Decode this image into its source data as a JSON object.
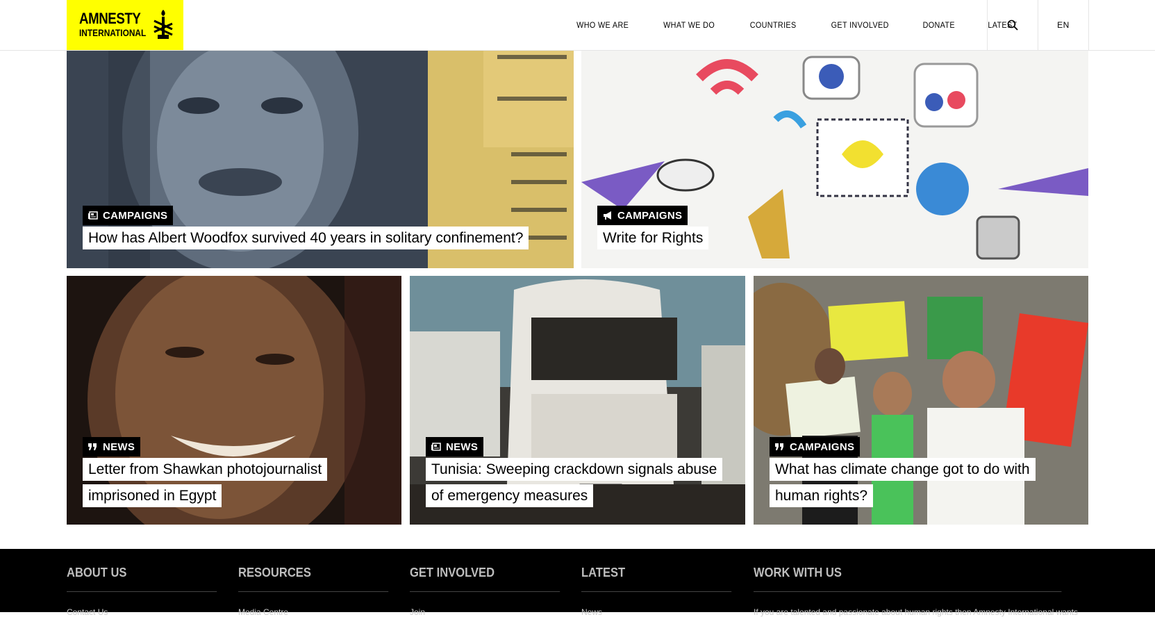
{
  "brand": {
    "line1": "AMNESTY",
    "line2": "INTERNATIONAL"
  },
  "nav": {
    "items": [
      "WHO WE ARE",
      "WHAT WE DO",
      "COUNTRIES",
      "GET INVOLVED",
      "DONATE",
      "LATEST"
    ],
    "search_icon": "search-icon",
    "language": "EN"
  },
  "cards": [
    {
      "tag": "CAMPAIGNS",
      "tag_icon": "newspaper-icon",
      "title": "How has Albert Woodfox survived 40 years in solitary confinement?"
    },
    {
      "tag": "CAMPAIGNS",
      "tag_icon": "megaphone-icon",
      "title": "Write for Rights"
    },
    {
      "tag": "NEWS",
      "tag_icon": "quote-icon",
      "title": "Letter from Shawkan photojournalist imprisoned in Egypt"
    },
    {
      "tag": "NEWS",
      "tag_icon": "newspaper-icon",
      "title": "Tunisia: Sweeping crackdown signals abuse of emergency measures"
    },
    {
      "tag": "CAMPAIGNS",
      "tag_icon": "quote-icon",
      "title": "What has climate change got to do with human rights?"
    }
  ],
  "footer": {
    "columns": [
      {
        "heading": "ABOUT US",
        "first": "Contact Us"
      },
      {
        "heading": "RESOURCES",
        "first": "Media Centre"
      },
      {
        "heading": "GET INVOLVED",
        "first": "Join"
      },
      {
        "heading": "LATEST",
        "first": "News"
      },
      {
        "heading": "WORK WITH US",
        "first": "If you are talented and passionate about human rights then Amnesty International wants"
      }
    ]
  },
  "colors": {
    "brand_yellow": "#ffff00",
    "tag_bg": "#000000",
    "footer_bg": "#000000"
  }
}
